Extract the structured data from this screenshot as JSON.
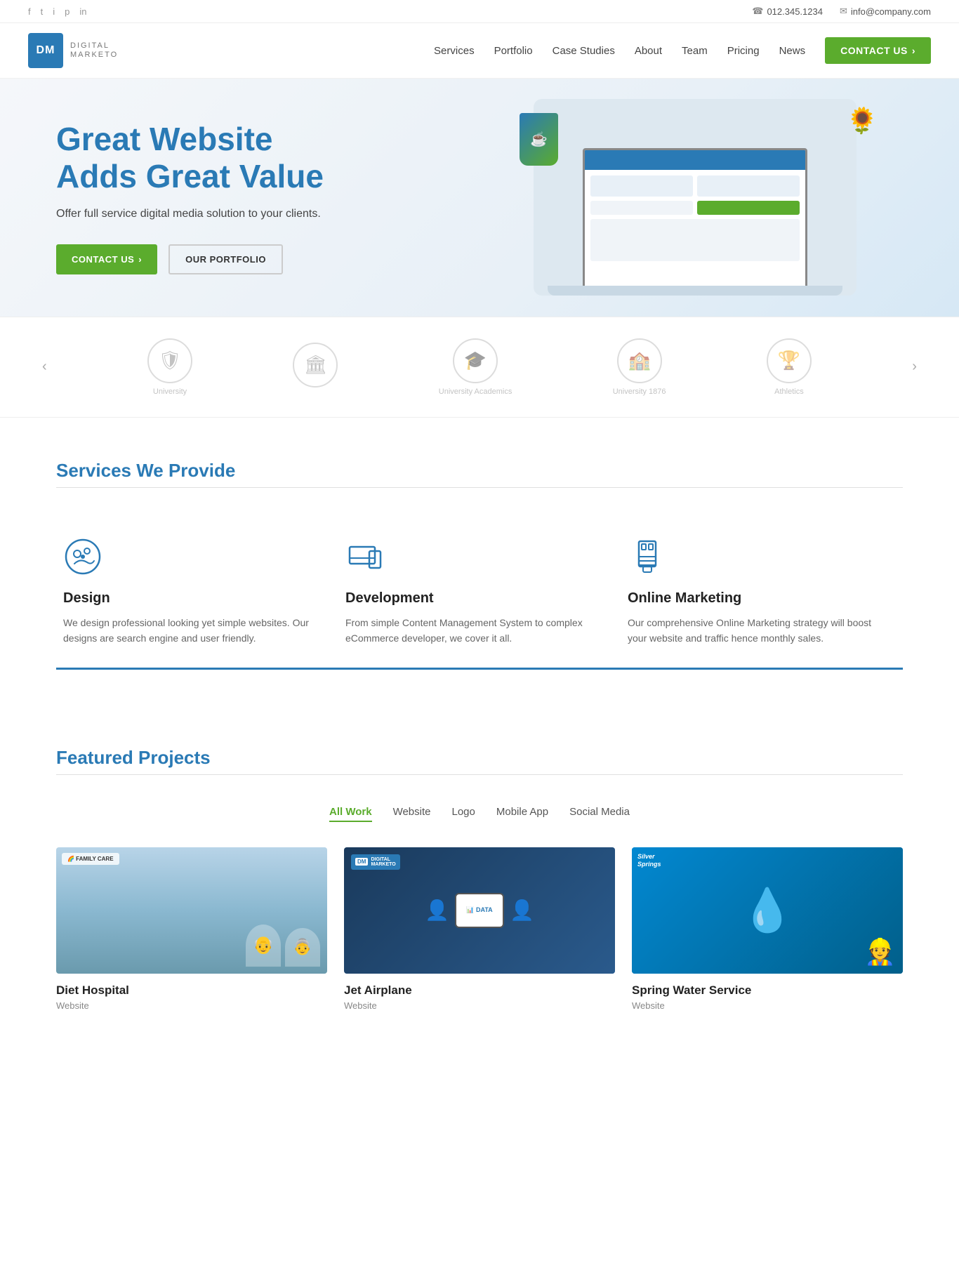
{
  "topbar": {
    "social": [
      "f",
      "t",
      "i",
      "p",
      "in"
    ],
    "phone_icon": "☎",
    "phone": "012.345.1234",
    "email_icon": "✉",
    "email": "info@company.com"
  },
  "nav": {
    "logo_text": "DM",
    "brand_name": "DIGITAL",
    "brand_sub": "MARKETO",
    "links": [
      "Services",
      "Portfolio",
      "Case Studies",
      "About",
      "Team",
      "Pricing",
      "News"
    ],
    "cta": "CONTACT US",
    "cta_arrow": "›"
  },
  "hero": {
    "title_line1": "Great Website",
    "title_line2": "Adds Great Value",
    "subtitle": "Offer full service digital media solution to your clients.",
    "btn_primary": "CONTACT US",
    "btn_primary_arrow": "›",
    "btn_secondary": "OUR PORTFOLIO"
  },
  "logos": {
    "prev": "‹",
    "next": "›",
    "items": [
      {
        "icon": "🛡",
        "label": "University"
      },
      {
        "icon": "🏛",
        "label": ""
      },
      {
        "icon": "🎓",
        "label": "University Academics"
      },
      {
        "icon": "🏫",
        "label": "University 1876"
      },
      {
        "icon": "🏆",
        "label": "Athletics"
      }
    ]
  },
  "services": {
    "title": "Services We Provide",
    "items": [
      {
        "title": "Design",
        "desc": "We design professional looking yet simple websites. Our designs are search engine and user friendly."
      },
      {
        "title": "Development",
        "desc": "From simple Content Management System to complex eCommerce developer, we cover it all."
      },
      {
        "title": "Online Marketing",
        "desc": "Our comprehensive Online Marketing strategy will boost your website and traffic hence monthly sales."
      }
    ]
  },
  "projects": {
    "title": "Featured Projects",
    "filters": [
      "All Work",
      "Website",
      "Logo",
      "Mobile App",
      "Social Media"
    ],
    "active_filter": 0,
    "items": [
      {
        "name": "Diet Hospital",
        "type": "Website"
      },
      {
        "name": "Jet Airplane",
        "type": "Website"
      },
      {
        "name": "Spring Water Service",
        "type": "Website"
      }
    ]
  }
}
